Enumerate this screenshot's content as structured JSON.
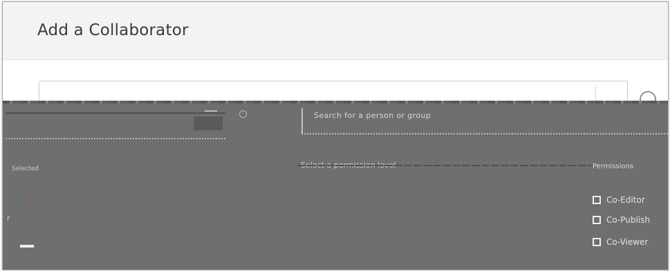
{
  "dialog": {
    "title": "Add a Collaborator",
    "search_text": "Search for a person or group",
    "left_label": "Selected",
    "middle_label": "Select a permission level",
    "permission_label": "Permissions",
    "left_marker": "r"
  },
  "permissions": [
    {
      "label": "Co-Editor"
    },
    {
      "label": "Co-Publish"
    },
    {
      "label": "Co-Viewer"
    }
  ],
  "colors": {
    "header_bg": "#f3f3f3",
    "overlay_bg": "#6f6f6f",
    "title": "#3a3a3a"
  },
  "icons": {
    "search": "search-icon",
    "checkbox": "checkbox-icon"
  }
}
